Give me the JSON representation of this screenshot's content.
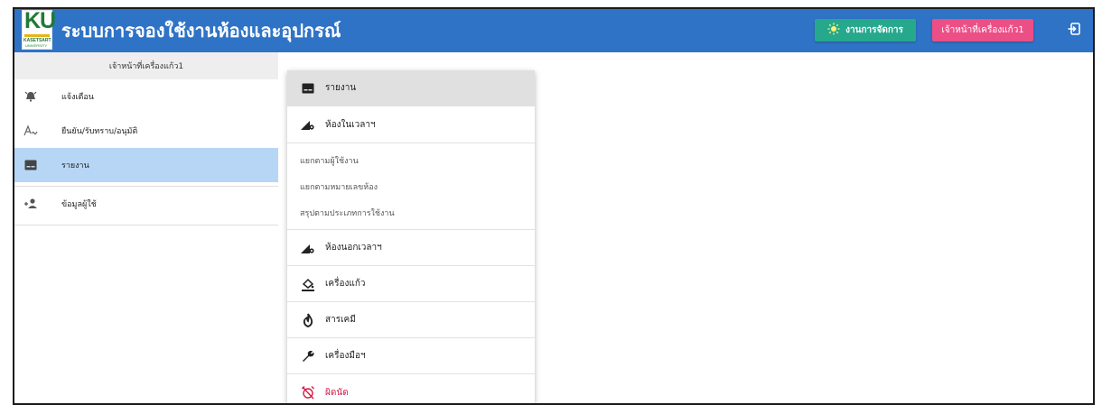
{
  "header": {
    "logo_text": "KU",
    "logo_sub1": "KASETSART",
    "logo_sub2": "UNIVERSITY",
    "title": "ระบบการจองใช้งานห้องและอุปกรณ์",
    "manage_button": "งานการจัดการ",
    "user_button": "เจ้าหน้าที่เครื่องแก้ว1",
    "logout_icon": "logout-icon",
    "colors": {
      "header_bg": "#2f73c6",
      "manage_bg": "#26a88d",
      "user_bg": "#ec4f86"
    }
  },
  "sidebar": {
    "user_label": "เจ้าหน้าที่เครื่องแก้ว1",
    "items": [
      {
        "label": "แจ้งเตือน",
        "icon": "alarm-icon",
        "active": false
      },
      {
        "label": "ยืนยัน/รับทราบ/อนุมัติ",
        "icon": "signature-icon",
        "active": false
      },
      {
        "label": "รายงาน",
        "icon": "report-icon",
        "active": true
      },
      {
        "label": "ข้อมูลผู้ใช้",
        "icon": "add-user-icon",
        "active": false
      }
    ],
    "active_color": "#b7d6f6"
  },
  "menu": {
    "items": [
      {
        "label": "รายงาน",
        "icon": "report-icon"
      },
      {
        "label": "ห้องในเวลาฯ",
        "icon": "room-settings-icon"
      }
    ],
    "subitems": [
      "แยกตามผู้ใช้งาน",
      "แยกตามหมายเลขห้อง",
      "สรุปตามประเภทการใช้งาน"
    ],
    "items_after": [
      {
        "label": "ห้องนอกเวลาฯ",
        "icon": "room-settings-icon"
      },
      {
        "label": "เครื่องแก้ว",
        "icon": "glassware-icon"
      },
      {
        "label": "สารเคมี",
        "icon": "chemical-icon"
      },
      {
        "label": "เครื่องมือฯ",
        "icon": "wrench-icon"
      },
      {
        "label": "ผิดนัด",
        "icon": "alarm-off-icon"
      }
    ],
    "danger_color": "#d81b48"
  }
}
